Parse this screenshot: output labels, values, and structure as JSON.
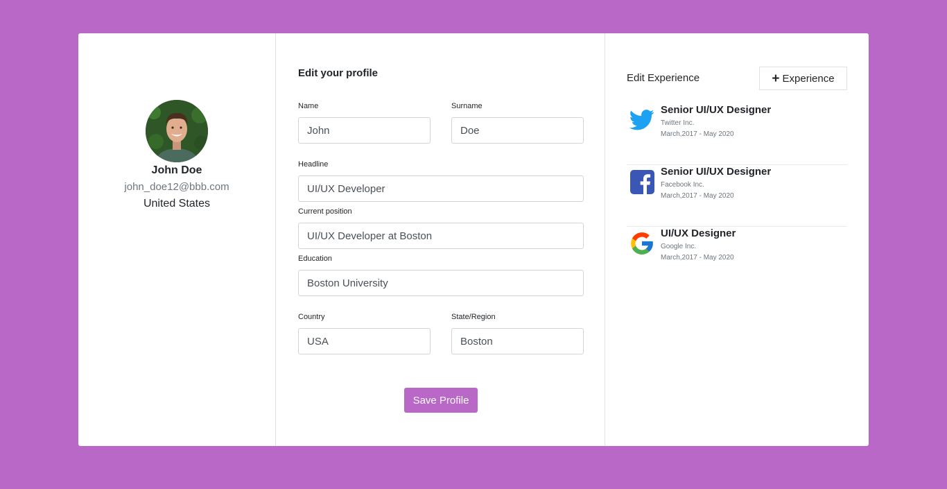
{
  "profile": {
    "name": "John Doe",
    "email": "john_doe12@bbb.com",
    "country": "United States"
  },
  "form": {
    "title": "Edit your profile",
    "name_label": "Name",
    "name_value": "John",
    "surname_label": "Surname",
    "surname_value": "Doe",
    "headline_label": "Headline",
    "headline_value": "UI/UX Developer",
    "position_label": "Current position",
    "position_value": "UI/UX Developer at Boston",
    "education_label": "Education",
    "education_value": "Boston University",
    "country_label": "Country",
    "country_value": "USA",
    "state_label": "State/Region",
    "state_value": "Boston",
    "save_label": "Save Profile"
  },
  "experience": {
    "title": "Edit Experience",
    "add_label": "Experience",
    "items": [
      {
        "role": "Senior UI/UX Designer",
        "company": "Twitter Inc.",
        "dates": "March,2017 - May 2020",
        "icon": "twitter-icon"
      },
      {
        "role": "Senior UI/UX Designer",
        "company": "Facebook Inc.",
        "dates": "March,2017 - May 2020",
        "icon": "facebook-icon"
      },
      {
        "role": "UI/UX Designer",
        "company": "Google Inc.",
        "dates": "March,2017 - May 2020",
        "icon": "google-icon"
      }
    ]
  },
  "colors": {
    "accent": "#ba68c8",
    "twitter": "#1da1f2",
    "facebook": "#3b5998"
  }
}
